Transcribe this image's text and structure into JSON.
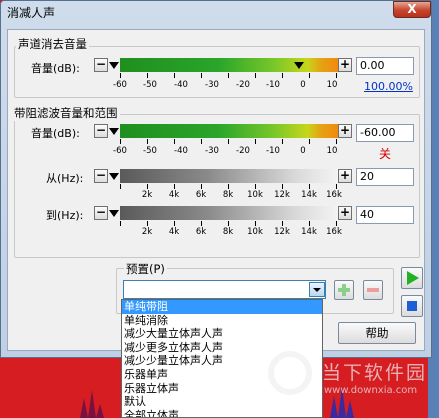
{
  "window": {
    "title": "消减人声",
    "close_label": "X"
  },
  "center_channel": {
    "group_label": "声道消去音量",
    "amplitude_label": "音量(dB):",
    "minus": "−",
    "plus": "+",
    "value": "0.00",
    "percent": "100.00%",
    "db_ticks": [
      "-60",
      "-50",
      "-40",
      "-30",
      "-20",
      "-10",
      "0",
      "10"
    ]
  },
  "band": {
    "group_label": "带阻滤波音量和范围",
    "amplitude_label": "音量(dB):",
    "amplitude_value": "-60.00",
    "state": "关",
    "from_label": "从(Hz):",
    "from_value": "20",
    "to_label": "到(Hz):",
    "to_value": "40",
    "db_ticks": [
      "-60",
      "-50",
      "-40",
      "-30",
      "-20",
      "-10",
      "0",
      "10"
    ],
    "hz_ticks": [
      "2k",
      "4k",
      "6k",
      "8k",
      "10k",
      "12k",
      "14k",
      "16k"
    ]
  },
  "presets": {
    "label": "预置(P)",
    "items": [
      "单纯带阻",
      "单纯消除",
      "减少大量立体声人声",
      "减少更多立体声人声",
      "减少少量立体声人声",
      "乐器单声",
      "乐器立体声",
      "默认",
      "全部立体声"
    ]
  },
  "buttons": {
    "help": "帮助"
  },
  "watermark": {
    "text": "当下软件园",
    "url": "www.downxia.com"
  },
  "colors": {
    "accent_blue": "#3399ff",
    "state_red": "#d00000",
    "link_blue": "#0033cc"
  }
}
